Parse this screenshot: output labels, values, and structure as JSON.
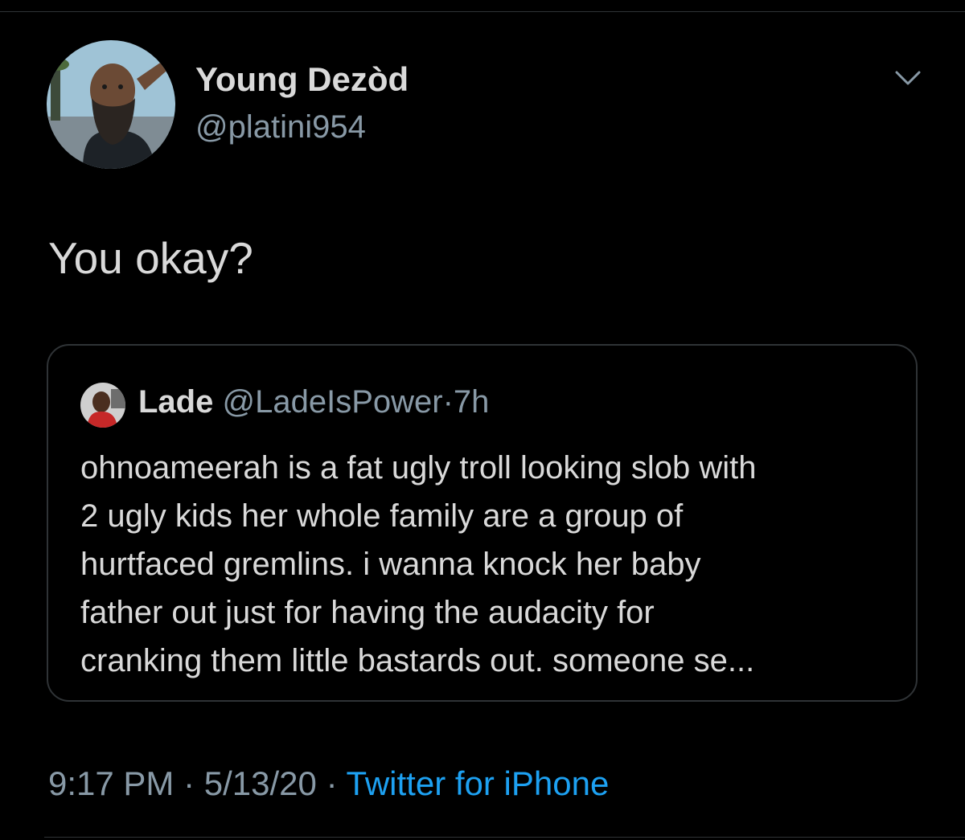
{
  "tweet": {
    "author": {
      "display_name": "Young Dezòd",
      "handle": "@platini954",
      "avatar_icon": "profile-photo"
    },
    "menu_icon": "chevron-down-icon",
    "text": "You okay?",
    "quoted": {
      "display_name": "Lade",
      "handle": "@LadeIsPower",
      "separator": "·",
      "time_ago": "7h",
      "avatar_icon": "profile-photo",
      "lines": [
        "ohnoameerah is a fat ugly troll looking slob with",
        "2 ugly kids her whole family are a group of",
        "hurtfaced gremlins. i wanna knock her baby",
        "father out just for having the audacity for",
        "cranking them little bastards out. someone se..."
      ]
    },
    "meta": {
      "time": "9:17 PM",
      "date": "5/13/20",
      "separator": "·",
      "source": "Twitter for iPhone"
    }
  },
  "colors": {
    "background": "#000000",
    "primary_text": "#d9d9d9",
    "secondary_text": "#8899a6",
    "link": "#1da1f2",
    "border": "#2f3336"
  }
}
